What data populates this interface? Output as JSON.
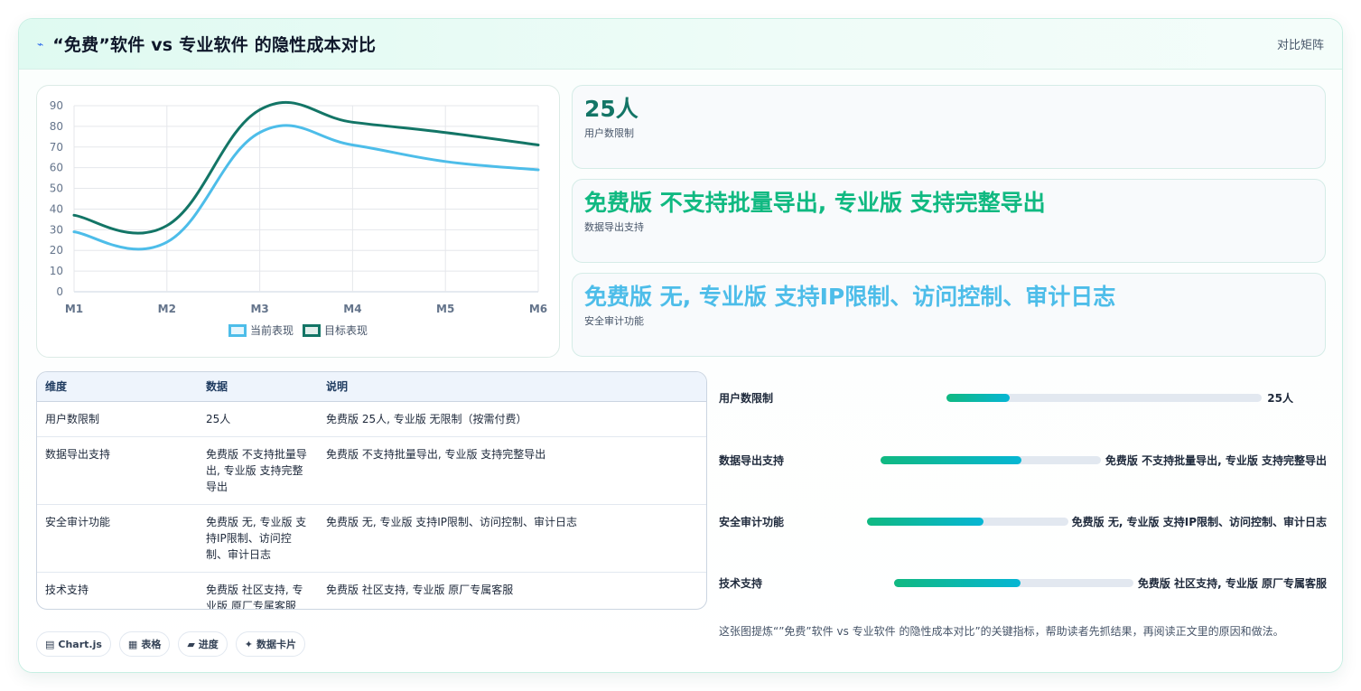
{
  "header": {
    "title": "“免费”软件 vs 专业软件 的隐性成本对比",
    "right_label": "对比矩阵",
    "icon": "bolt-icon"
  },
  "chart_data": {
    "type": "line",
    "x": [
      "M1",
      "M2",
      "M3",
      "M4",
      "M5",
      "M6"
    ],
    "ylim": [
      0,
      90
    ],
    "yticks": [
      0,
      10,
      20,
      30,
      40,
      50,
      60,
      70,
      80,
      90
    ],
    "grid": true,
    "legend": "bottom",
    "series": [
      {
        "name": "当前表现",
        "values": [
          29,
          24,
          77,
          71,
          63,
          59
        ],
        "color": "#4dbde9"
      },
      {
        "name": "目标表现",
        "values": [
          37,
          32,
          88,
          82,
          77,
          71
        ],
        "color": "#137566"
      }
    ]
  },
  "stats": [
    {
      "value": "25人",
      "label": "用户数限制",
      "color": "#137566"
    },
    {
      "value": "免费版 不支持批量导出, 专业版 支持完整导出",
      "label": "数据导出支持",
      "color": "#10b981"
    },
    {
      "value": "免费版 无, 专业版 支持IP限制、访问控制、审计日志",
      "label": "安全审计功能",
      "color": "#4dbde9"
    }
  ],
  "table": {
    "headers": [
      "维度",
      "数据",
      "说明"
    ],
    "rows": [
      [
        "用户数限制",
        "25人",
        "免费版 25人, 专业版 无限制（按需付费）"
      ],
      [
        "数据导出支持",
        "免费版 不支持批量导出, 专业版 支持完整导出",
        "免费版 不支持批量导出, 专业版 支持完整导出"
      ],
      [
        "安全审计功能",
        "免费版 无, 专业版 支持IP限制、访问控制、审计日志",
        "免费版 无, 专业版 支持IP限制、访问控制、审计日志"
      ],
      [
        "技术支持",
        "免费版 社区支持, 专业版 原厂专属客服",
        "免费版 社区支持, 专业版 原厂专属客服"
      ]
    ]
  },
  "progress": [
    {
      "label": "用户数限制",
      "value": "25人",
      "fraction": 0.2
    },
    {
      "label": "数据导出支持",
      "value": "免费版 不支持批量导出, 专业版 支持完整导出",
      "fraction": 0.64
    },
    {
      "label": "安全审计功能",
      "value": "免费版 无, 专业版 支持IP限制、访问控制、审计日志",
      "fraction": 0.58
    },
    {
      "label": "技术支持",
      "value": "免费版 社区支持, 专业版 原厂专属客服",
      "fraction": 0.53
    }
  ],
  "chips": [
    {
      "icon": "chart-icon",
      "label": "Chart.js"
    },
    {
      "icon": "table-icon",
      "label": "表格"
    },
    {
      "icon": "progress-icon",
      "label": "进度"
    },
    {
      "icon": "sparkle-icon",
      "label": "数据卡片"
    }
  ],
  "note": "这张图提炼“”免费”软件 vs 专业软件 的隐性成本对比”的关键指标，帮助读者先抓结果，再阅读正文里的原因和做法。"
}
